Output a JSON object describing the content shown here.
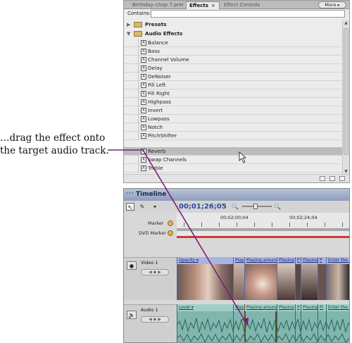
{
  "callout": {
    "line1": "…drag the effect onto",
    "line2": "the target audio track."
  },
  "effects_panel": {
    "tabs": [
      {
        "label": "Birthday–chap 7.prel"
      },
      {
        "label": "Effects",
        "close": "×"
      },
      {
        "label": "Effect Controls"
      }
    ],
    "more_label": "More ▸",
    "contains_label": "Contains:",
    "contains_value": "",
    "presets_label": "Presets",
    "audio_effects_label": "Audio Effects",
    "items": [
      "Balance",
      "Bass",
      "Channel Volume",
      "Delay",
      "DeNoiser",
      "Fill Left",
      "Fill Right",
      "Highpass",
      "Invert",
      "Lowpass",
      "Notch",
      "PitchShifter",
      "Reverb",
      "Swap Channels",
      "Treble"
    ],
    "selected_item": "Reverb"
  },
  "timeline": {
    "title": "Timeline",
    "timecode": "00;01;26;05",
    "ruler_labels": [
      "00;02;00;04",
      "00;02;24;04"
    ],
    "marker_label": "Marker",
    "dvd_marker_label": "DVD Marker",
    "video_track": {
      "name": "Video 1",
      "clips": [
        "Opacity ▾",
        "Play",
        "Playing around",
        "Playing",
        "P",
        "Playing",
        "P",
        "Enter the cl"
      ]
    },
    "audio_track": {
      "name": "Audio 1",
      "level_label": "Level ▾",
      "clips": [
        "Play",
        "Playing around",
        "Playing",
        "P",
        "Playing",
        "Pi",
        "Enter the cl"
      ]
    }
  },
  "colors": {
    "title_bar": "#8d9dbb",
    "video_clip_header": "#a8b4e2",
    "audio_clip": "#7fb6ad",
    "drag_line": "#7b1f7a",
    "timecode": "#2a4a9a"
  }
}
